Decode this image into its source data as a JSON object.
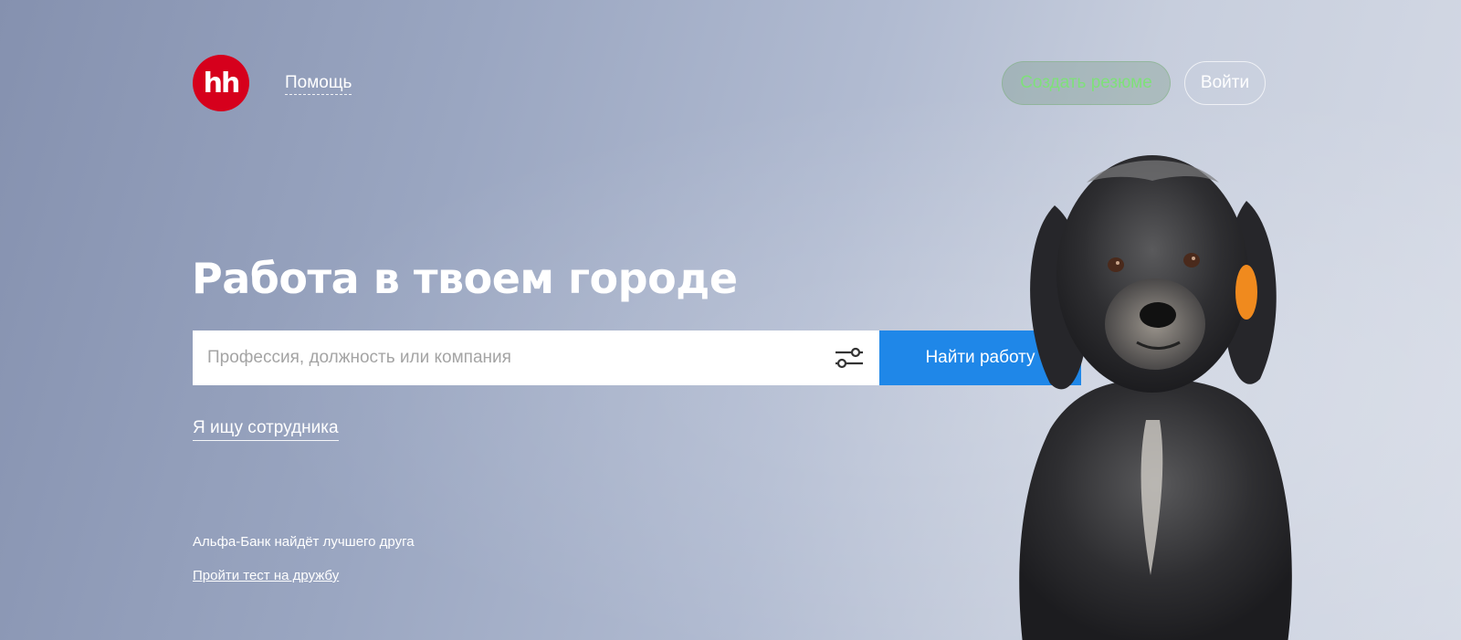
{
  "header": {
    "logo_text": "hh",
    "help_link": "Помощь",
    "create_resume_button": "Создать резюме",
    "login_button": "Войти"
  },
  "hero": {
    "headline": "Работа в твоем городе"
  },
  "search": {
    "placeholder": "Профессия, должность или компания",
    "button_label": "Найти работу",
    "filter_icon": "filter-sliders-icon"
  },
  "employer_link": "Я ищу сотрудника",
  "promo": {
    "text": "Альфа-Банк найдёт лучшего друга",
    "link": "Пройти тест на дружбу"
  },
  "colors": {
    "brand_red": "#d6001c",
    "search_button_blue": "#1f87e8",
    "resume_button_text": "#7fe07a"
  }
}
